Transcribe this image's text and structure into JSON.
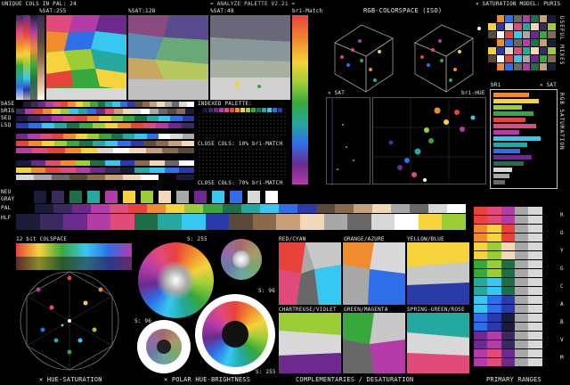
{
  "header": {
    "unique_cols": "UNIQUE COLS IN PAL: 24",
    "sat255": "%SAT:255",
    "sat128": "%SAT:128",
    "sat48": "%SAT:48",
    "title": "= ANALYZE PALETTE V2.21 =",
    "bri_match": "bri-Match",
    "rgb_colorspace": "RGB-COLORSPACE (ISO)",
    "saturation_model": "✕ SATURATION MODEL: PURIS"
  },
  "sections": {
    "indexed_palette": "INDEXED PALETTE:",
    "close_cols_10": "CLOSE COLS: 10% bri-MATCH",
    "close_cols_70": "CLOSE COLS: 70% bri-MATCH",
    "x_sat": "✕ SAT",
    "bri_hue": "bri-HUE",
    "bri": "bRi",
    "sat_small": "✕ SAT",
    "colspace_12bit": "12 bit COLSPACE",
    "s255_a": "S: 255",
    "s96_a": "S: 96",
    "s96_b": "S: 96",
    "s255_b": "S: 255"
  },
  "left_labels": [
    "bASE",
    "bRIG",
    "SEQ",
    "LSQ"
  ],
  "mid_labels": [
    "NEU",
    "GRAY",
    "PAL",
    "HLF"
  ],
  "right_vertical": {
    "useful_mixes": "USEFUL MIXES",
    "sat_rows": "RGB SATURATION",
    "roygcabvm": [
      "R",
      "O",
      "Y",
      "G",
      "C",
      "A",
      "B",
      "V",
      "M"
    ]
  },
  "complementaries": [
    "RED/CYAN",
    "ORANGE/AZURE",
    "YELLOW/BLUE",
    "CHARTREUSE/VIOLET",
    "GREEN/MAGENTA",
    "SPRING-GREEN/ROSE"
  ],
  "footer": {
    "hue_sat": "✕ HUE-SATURATION",
    "polar": "✕ POLAR HUE-BRIGHTNESS",
    "comp": "COMPLEMENTARIES / DESATURATION",
    "primary": "PRIMARY RANGES"
  },
  "palette": [
    "#000000",
    "#1b1b3a",
    "#3a2a5e",
    "#6c2a8e",
    "#b43ca8",
    "#e04b7b",
    "#e8423c",
    "#f08c2e",
    "#f5d33b",
    "#9ccd36",
    "#36a83c",
    "#1f6e4a",
    "#24a8a0",
    "#36c8f0",
    "#2e6ee8",
    "#2a3aa8",
    "#5a4a3a",
    "#8a6a4a",
    "#c8a078",
    "#f0d8b8",
    "#a8a8a8",
    "#686868",
    "#d8d8d8",
    "#ffffff"
  ]
}
